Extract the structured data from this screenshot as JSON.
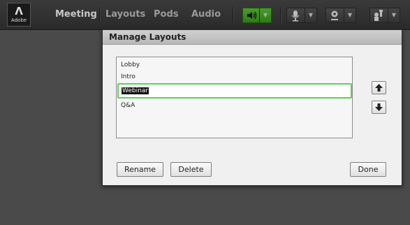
{
  "app": {
    "logo_text": "Adobe",
    "menu": [
      "Meeting",
      "Layouts",
      "Pods",
      "Audio"
    ]
  },
  "toolbar": {
    "icons": [
      "speaker-icon",
      "microphone-icon",
      "webcam-icon",
      "raise-hand-icon"
    ],
    "accent_color": "#3f8f22"
  },
  "dialog": {
    "title": "Manage Layouts",
    "layouts": [
      "Lobby",
      "Intro",
      "Webinar",
      "Q&A"
    ],
    "editing_value": "Webinar",
    "buttons": {
      "rename": "Rename",
      "delete": "Delete",
      "done": "Done"
    },
    "icons": [
      "arrow-up-icon",
      "arrow-down-icon"
    ]
  }
}
